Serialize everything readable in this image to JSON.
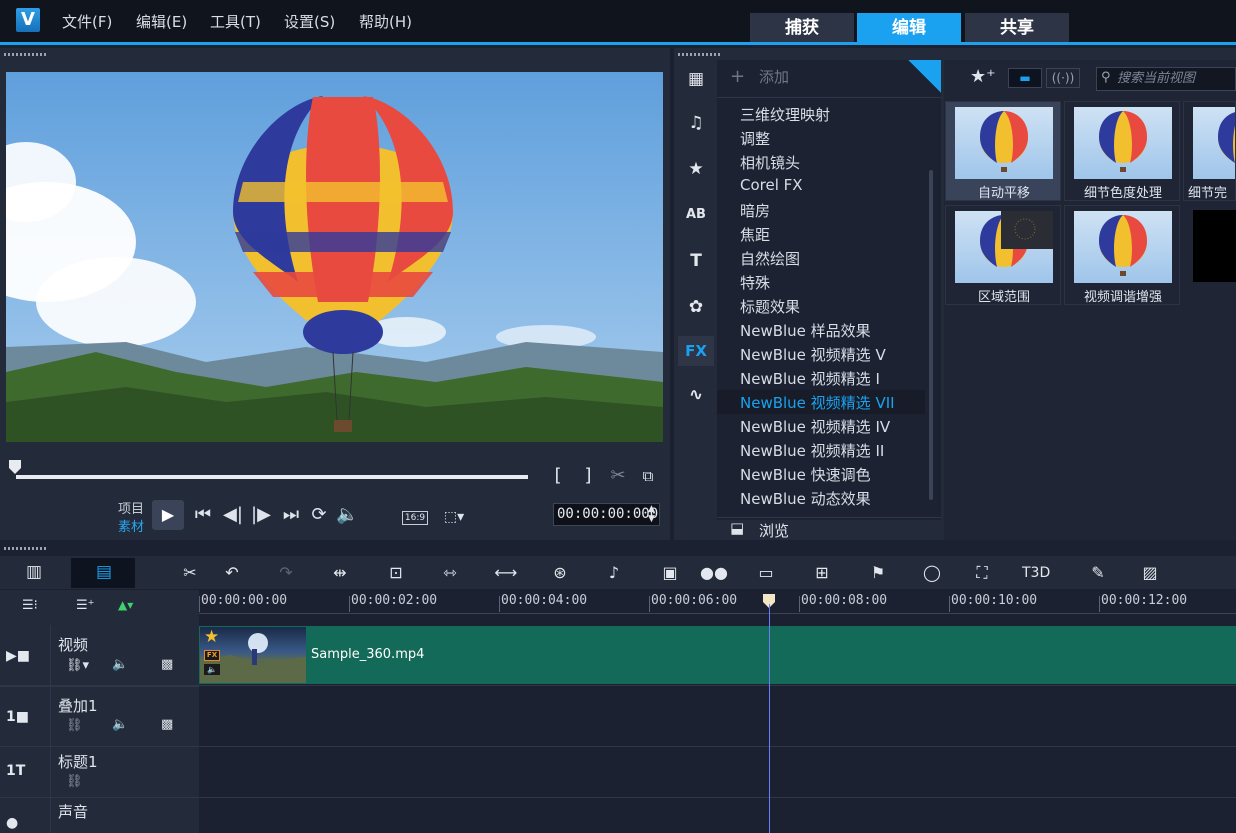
{
  "app": {
    "logo": "V"
  },
  "menu": [
    "文件(F)",
    "编辑(E)",
    "工具(T)",
    "设置(S)",
    "帮助(H)"
  ],
  "mode_tabs": [
    {
      "label": "捕获",
      "active": false
    },
    {
      "label": "编辑",
      "active": true
    },
    {
      "label": "共享",
      "active": false
    }
  ],
  "accent": "#1aa2f0",
  "player": {
    "project_label": "项目",
    "clip_label": "素材",
    "timecode": "00:00:00:000",
    "aspect": "16:9"
  },
  "library": {
    "add_label": "添加",
    "categories": [
      "三维纹理映射",
      "调整",
      "相机镜头",
      "Corel FX",
      "暗房",
      "焦距",
      "自然绘图",
      "特殊",
      "标题效果",
      "NewBlue 样品效果",
      "NewBlue 视频精选 V",
      "NewBlue 视频精选 I",
      "NewBlue 视频精选 VII",
      "NewBlue 视频精选 IV",
      "NewBlue 视频精选 II",
      "NewBlue 快速调色",
      "NewBlue 动态效果"
    ],
    "selected_category": "NewBlue 视频精选 VII",
    "browse_label": "浏览",
    "search_placeholder": "搜索当前视图",
    "thumbnails": [
      {
        "label": "自动平移"
      },
      {
        "label": "细节色度处理"
      },
      {
        "label": "细节完"
      },
      {
        "label": "区域范围"
      },
      {
        "label": "视频调谐增强"
      }
    ]
  },
  "timeline": {
    "ticks": [
      "00:00:00:00",
      "00:00:02:00",
      "00:00:04:00",
      "00:00:06:00",
      "00:00:08:00",
      "00:00:10:00",
      "00:00:12:00"
    ],
    "tracks": [
      {
        "name": "视频"
      },
      {
        "name": "叠加1"
      },
      {
        "name": "标题1"
      },
      {
        "name": "声音"
      }
    ],
    "clip": {
      "name": "Sample_360.mp4",
      "badge_fx": "FX"
    }
  }
}
